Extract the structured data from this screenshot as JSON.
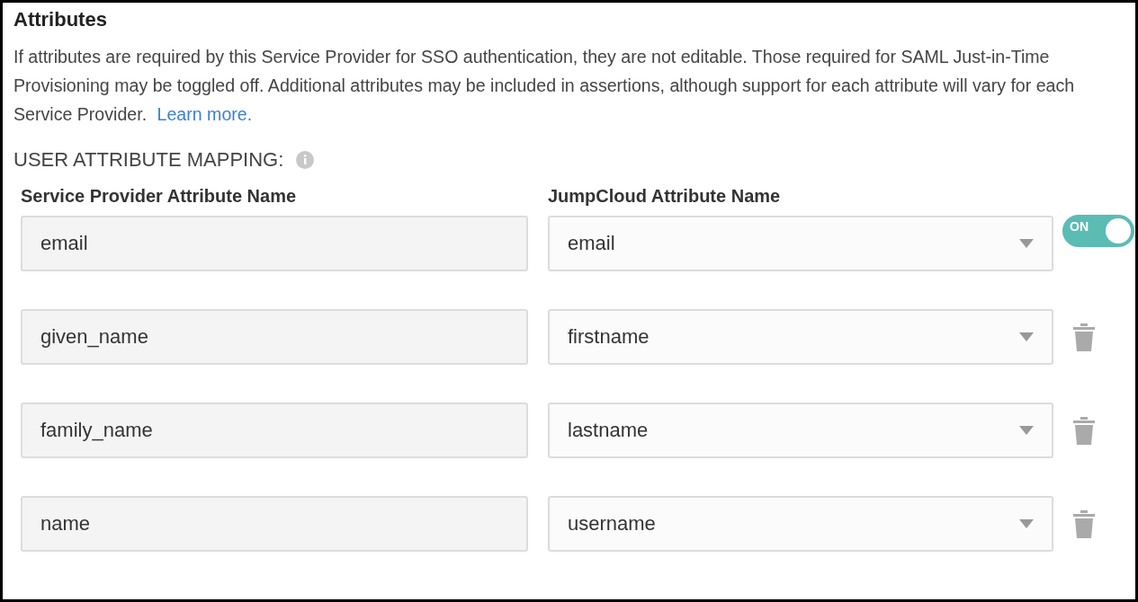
{
  "section": {
    "title": "Attributes",
    "description": "If attributes are required by this Service Provider for SSO authentication, they are not editable. Those required for SAML Just-in-Time Provisioning may be toggled off. Additional attributes may be included in assertions, although support for each attribute will vary for each Service Provider.",
    "learn_more": "Learn more."
  },
  "mapping": {
    "label": "USER ATTRIBUTE MAPPING:",
    "columns": [
      "Service Provider Attribute Name",
      "JumpCloud Attribute Name"
    ],
    "rows": [
      {
        "sp_attribute": "email",
        "jc_attribute": "email",
        "kind": "toggle",
        "on": true,
        "toggle_label": "ON"
      },
      {
        "sp_attribute": "given_name",
        "jc_attribute": "firstname",
        "kind": "delete"
      },
      {
        "sp_attribute": "family_name",
        "jc_attribute": "lastname",
        "kind": "delete"
      },
      {
        "sp_attribute": "name",
        "jc_attribute": "username",
        "kind": "delete"
      }
    ]
  }
}
